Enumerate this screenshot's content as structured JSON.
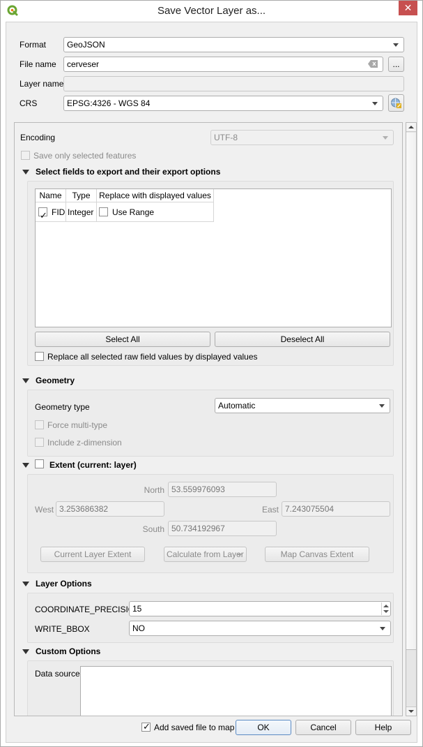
{
  "window": {
    "title": "Save Vector Layer as...",
    "close_label": "✕",
    "app_icon": "qgis-logo-icon"
  },
  "top_form": {
    "format_label": "Format",
    "format_value": "GeoJSON",
    "filename_label": "File name",
    "filename_value": "cerveser",
    "browse_label": "...",
    "layername_label": "Layer name",
    "layername_value": "",
    "crs_label": "CRS",
    "crs_value": "EPSG:4326 - WGS 84",
    "crs_select_icon": "crs-globe-icon"
  },
  "options": {
    "encoding_label": "Encoding",
    "encoding_value": "UTF-8",
    "save_selected_label": "Save only selected features",
    "save_selected_checked": false,
    "fields_section": {
      "title": "Select fields to export and their export options",
      "columns": [
        "Name",
        "Type",
        "Replace with displayed values"
      ],
      "rows": [
        {
          "checked": true,
          "name": "FID",
          "type": "Integer",
          "replace_checked": false,
          "replace_label": "Use Range"
        }
      ],
      "select_all_label": "Select All",
      "deselect_all_label": "Deselect All",
      "replace_all_label": "Replace all selected raw field values by displayed values",
      "replace_all_checked": false
    },
    "geometry_section": {
      "title": "Geometry",
      "type_label": "Geometry type",
      "type_value": "Automatic",
      "force_multi_label": "Force multi-type",
      "include_z_label": "Include z-dimension"
    },
    "extent_section": {
      "title": "Extent (current: layer)",
      "enabled": false,
      "north_label": "North",
      "north_value": "53.559976093",
      "west_label": "West",
      "west_value": "3.253686382",
      "east_label": "East",
      "east_value": "7.243075504",
      "south_label": "South",
      "south_value": "50.734192967",
      "current_layer_extent_label": "Current Layer Extent",
      "calculate_from_layer_label": "Calculate from Layer",
      "map_canvas_extent_label": "Map Canvas Extent"
    },
    "layer_options_section": {
      "title": "Layer Options",
      "coord_precision_label": "COORDINATE_PRECISION",
      "coord_precision_value": "15",
      "write_bbox_label": "WRITE_BBOX",
      "write_bbox_value": "NO"
    },
    "custom_options_section": {
      "title": "Custom Options",
      "data_source_label": "Data source",
      "data_source_value": ""
    }
  },
  "footer": {
    "add_to_map_label": "Add saved file to map",
    "add_to_map_checked": true,
    "ok_label": "OK",
    "cancel_label": "Cancel",
    "help_label": "Help"
  }
}
